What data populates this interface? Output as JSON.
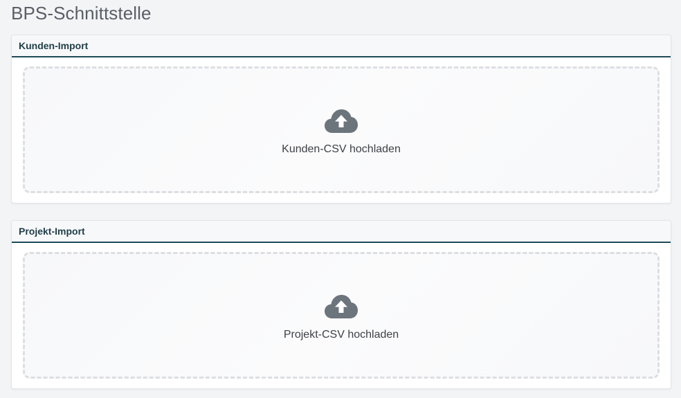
{
  "page": {
    "title": "BPS-Schnittstelle"
  },
  "sections": [
    {
      "header": "Kunden-Import",
      "upload_label": "Kunden-CSV hochladen",
      "icon": "cloud-upload-icon"
    },
    {
      "header": "Projekt-Import",
      "upload_label": "Projekt-CSV hochladen",
      "icon": "cloud-upload-icon"
    }
  ],
  "colors": {
    "accent_border": "#1e4a57",
    "header_text": "#1f3d47",
    "icon": "#6c747c",
    "dropzone_border": "#dcdee2"
  }
}
